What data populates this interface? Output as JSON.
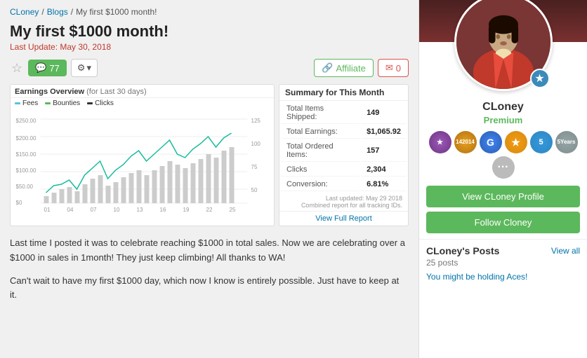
{
  "breadcrumb": {
    "user": "CLoney",
    "separator1": "/",
    "blogs": "Blogs",
    "separator2": "/",
    "current": "My first $1000 month!"
  },
  "page": {
    "title": "My first $1000 month!",
    "last_update_label": "Last Update:",
    "last_update_date": "May 30, 2018"
  },
  "toolbar": {
    "comment_count": "77",
    "settings_label": "⚙",
    "dropdown_label": "▾",
    "affiliate_label": "Affiliate",
    "mail_count": "0"
  },
  "chart": {
    "title": "Earnings Overview",
    "period": "(for Last 30 days)",
    "legends": [
      {
        "label": "Fees",
        "color": "#5bc0de"
      },
      {
        "label": "Bounties",
        "color": "#5cb85c"
      },
      {
        "label": "Clicks",
        "color": "#333"
      }
    ]
  },
  "summary": {
    "title": "Summary for This Month",
    "rows": [
      {
        "label": "Total Items Shipped:",
        "value": "149"
      },
      {
        "label": "Total Earnings:",
        "value": "$1,065.92"
      },
      {
        "label": "Total Ordered Items:",
        "value": "157"
      },
      {
        "label": "Clicks",
        "value": "2,304"
      },
      {
        "label": "Conversion:",
        "value": "6.81%"
      }
    ],
    "footer1": "Last updated: May 29 2018",
    "footer2": "Combined report for all tracking IDs.",
    "view_full_report": "View Full Report"
  },
  "blog": {
    "para1": "Last time I posted it was to celebrate reaching $1000 in total sales. Now we are celebrating over a $1000 in sales in 1month! They just keep climbing! All thanks to WA!",
    "para2": "Can't wait to have my first $1000 day, which now I know is entirely possible. Just have to keep at it."
  },
  "sidebar": {
    "username": "CLoney",
    "level": "Premium",
    "badges": [
      {
        "name": "purple-badge",
        "content": "★"
      },
      {
        "name": "year-2014-badge",
        "content": "14\n2014"
      },
      {
        "name": "google-badge",
        "content": "G"
      },
      {
        "name": "star-badge",
        "content": "★"
      },
      {
        "name": "five-badge",
        "content": "5"
      },
      {
        "name": "years-badge",
        "content": "5\nYears"
      },
      {
        "name": "more-badge",
        "content": "···"
      }
    ],
    "view_profile_btn": "View CLoney Profile",
    "follow_btn": "Follow Cloney",
    "posts_title": "CLoney's Posts",
    "posts_count": "25 posts",
    "view_all": "View all",
    "post_link": "You might be holding Aces!"
  }
}
